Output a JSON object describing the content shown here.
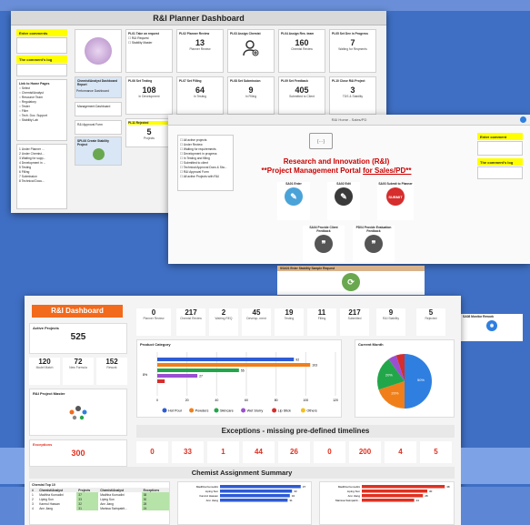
{
  "w1": {
    "title": "R&I Planner Dashboard",
    "enter_comments": "Enter comments",
    "comments_log": "The comment's log",
    "links": {
      "header": "Link to Home Pages",
      "items": [
        "Select",
        "Chemist/Analyst",
        "Resource Team",
        "Regulatory",
        "Tester",
        "Filler",
        "Tech. Doc. Support",
        "Stability Lab"
      ]
    },
    "planner_list": [
      "1 Under Planner ...",
      "2 Under Chemist...",
      "3 Waiting for supp...",
      "4 Development in ...",
      "5 Testing",
      "6 Filling",
      "7 Submission",
      "8 Technical Docu..."
    ],
    "tile_request": {
      "title": "PL01 Take on request",
      "opts": [
        "R&I Request",
        "Stability Master"
      ]
    },
    "tile_review": {
      "title": "PL02 Planner Review",
      "value": "13",
      "sub": "Planner Review"
    },
    "tile_assign": {
      "title": "PL03 Assign Chemist"
    },
    "tile_assign_res": {
      "title": "PL04 Assign Res. team",
      "value": "160",
      "sub": "Chemist Review"
    },
    "tile_progress": {
      "title": "PL05 Set Dev in Progress",
      "value": "7",
      "sub": "Waiting for Reqments"
    },
    "analyst_report": "Chemist/Analyst Dashboard Report",
    "perf_dashboard": "Performance Dashboard",
    "mgmt_dashboard": "Management Dashboard",
    "approval_form": "R&I Approval Form",
    "stability_project": "SPL06 Create Stability Project",
    "tile_testing": {
      "title": "PL06 Set Testing",
      "value": "108",
      "sub": "In Development"
    },
    "tile_filling": {
      "title": "PL07 Set Filling",
      "value": "64",
      "sub": "In Testing"
    },
    "tile_submission": {
      "title": "PL08 Set Submission",
      "value": "9",
      "sub": "In Filling"
    },
    "tile_feedback": {
      "title": "PL09 Set Feedback",
      "value": "405",
      "sub": "Submitted to Client"
    },
    "tile_close": {
      "title": "PL10 Close R&I Project",
      "value": "3",
      "sub": "TDS & Stability"
    },
    "rejected": {
      "title": "PL11 Rejected",
      "value": "5",
      "sub": "Projects"
    }
  },
  "w2": {
    "tab": "R&I Home - Sales/PD",
    "list": [
      "All active projects",
      "Under Review",
      "Waiting for requirements",
      "Development in progress",
      "In Testing and filling",
      "Submitted to client",
      "Technical Approval Docs & Sta...",
      "R&I Approval Form",
      "All active Projects with R&I"
    ],
    "title1": "Research and Innovation (R&I)",
    "title2": "**Project Management Portal ",
    "title3": "for Sales/PD**",
    "enter_comments": "Enter comment",
    "comments_log": "The comment's log",
    "cards": [
      "SA01 Enter",
      "SA02 Edit",
      "SA03 Submit to Planner",
      "SA04 Provide Client Feedback",
      "PD04 Provide Evaluation Feedback"
    ],
    "stability": "SSA01 Enter Stability Sample Request",
    "monitor": "SA08 Monitor Rework"
  },
  "w3": {
    "title": "R&I Dashboard",
    "active_label": "Active Projects",
    "active_value": "525",
    "mini": [
      {
        "v": "120",
        "l": "Model Match"
      },
      {
        "v": "72",
        "l": "New Formula"
      },
      {
        "v": "152",
        "l": "Rework"
      }
    ],
    "master": "R&I Project Master",
    "exceptions_label": "Exceptions",
    "exceptions_value": "300",
    "stats": [
      {
        "v": "0",
        "l": "Planner Review"
      },
      {
        "v": "217",
        "l": "Chemist Review"
      },
      {
        "v": "2",
        "l": "Waiting REQ"
      },
      {
        "v": "45",
        "l": "Develop- ment"
      },
      {
        "v": "19",
        "l": "Testing"
      },
      {
        "v": "11",
        "l": "Filling"
      },
      {
        "v": "217",
        "l": "Submitted"
      },
      {
        "v": "9",
        "l": "R&I Stability"
      },
      {
        "v": "5",
        "l": "Rejected"
      }
    ],
    "category_title": "Product Category",
    "current_month": "Current Month",
    "exceptions_band": "Exceptions - missing pre-defined timelines",
    "exc_values": [
      "0",
      "33",
      "1",
      "44",
      "26",
      "0",
      "200",
      "4",
      "5"
    ],
    "summary_band": "Chemist Assignment  Summary",
    "top10": {
      "title": "Chemist Top 10",
      "headers": [
        "#",
        "Chemist/Analyst",
        "Projects",
        "Chemist/Analyst",
        "Exceptions"
      ],
      "rows": [
        [
          "1",
          "Madhha Kumudini",
          "37",
          "Madhha Kumudini",
          "38"
        ],
        [
          "2",
          "Liping Sun",
          "33",
          "Liping Sun",
          "30"
        ],
        [
          "3",
          "Kamrul Hassan",
          "32",
          "Ann Jiang",
          "28"
        ],
        [
          "4",
          "Ann Jiang",
          "31",
          "Marissa Swinpatrit...",
          "24"
        ]
      ]
    }
  },
  "chart_data": [
    {
      "type": "bar",
      "title": "Product Category",
      "orientation": "horizontal",
      "series": [
        {
          "name": "Hot Pour",
          "values": [
            92
          ],
          "color": "#2e5bd6"
        },
        {
          "name": "Powders",
          "values": [
            103
          ],
          "color": "#f07f1a"
        },
        {
          "name": "Skincare",
          "values": [
            55
          ],
          "color": "#22a64a"
        },
        {
          "name": "Wet Slurry",
          "values": [
            27
          ],
          "color": "#9b4fd0"
        },
        {
          "name": "Lip Stick",
          "values": [
            5
          ],
          "color": "#d62d2d"
        },
        {
          "name": "Others",
          "values": [
            0
          ],
          "color": "#f2c21b"
        }
      ],
      "value_labels": [
        "92",
        "103",
        "55",
        "27"
      ],
      "y_label": "8%",
      "xlim": [
        0,
        120
      ],
      "xticks": [
        "0",
        "20",
        "40",
        "60",
        "80",
        "100",
        "120"
      ]
    },
    {
      "type": "pie",
      "title": "Current Month",
      "slices": [
        {
          "name": "Hot Pour",
          "value": 50,
          "color": "#2e7fe0"
        },
        {
          "name": "Powders",
          "value": 20,
          "color": "#f07f1a"
        },
        {
          "name": "Skincare",
          "value": 20,
          "color": "#22a64a"
        },
        {
          "name": "Wet Slurry",
          "value": 5,
          "color": "#9b4fd0"
        },
        {
          "name": "Lip Stick",
          "value": 5,
          "color": "#d62d2d"
        }
      ],
      "labels": [
        "50%",
        "20%",
        "20%"
      ]
    }
  ],
  "colors": {
    "accent_orange": "#f26a1b",
    "red": "#e03020",
    "yellow": "#ffff00"
  }
}
